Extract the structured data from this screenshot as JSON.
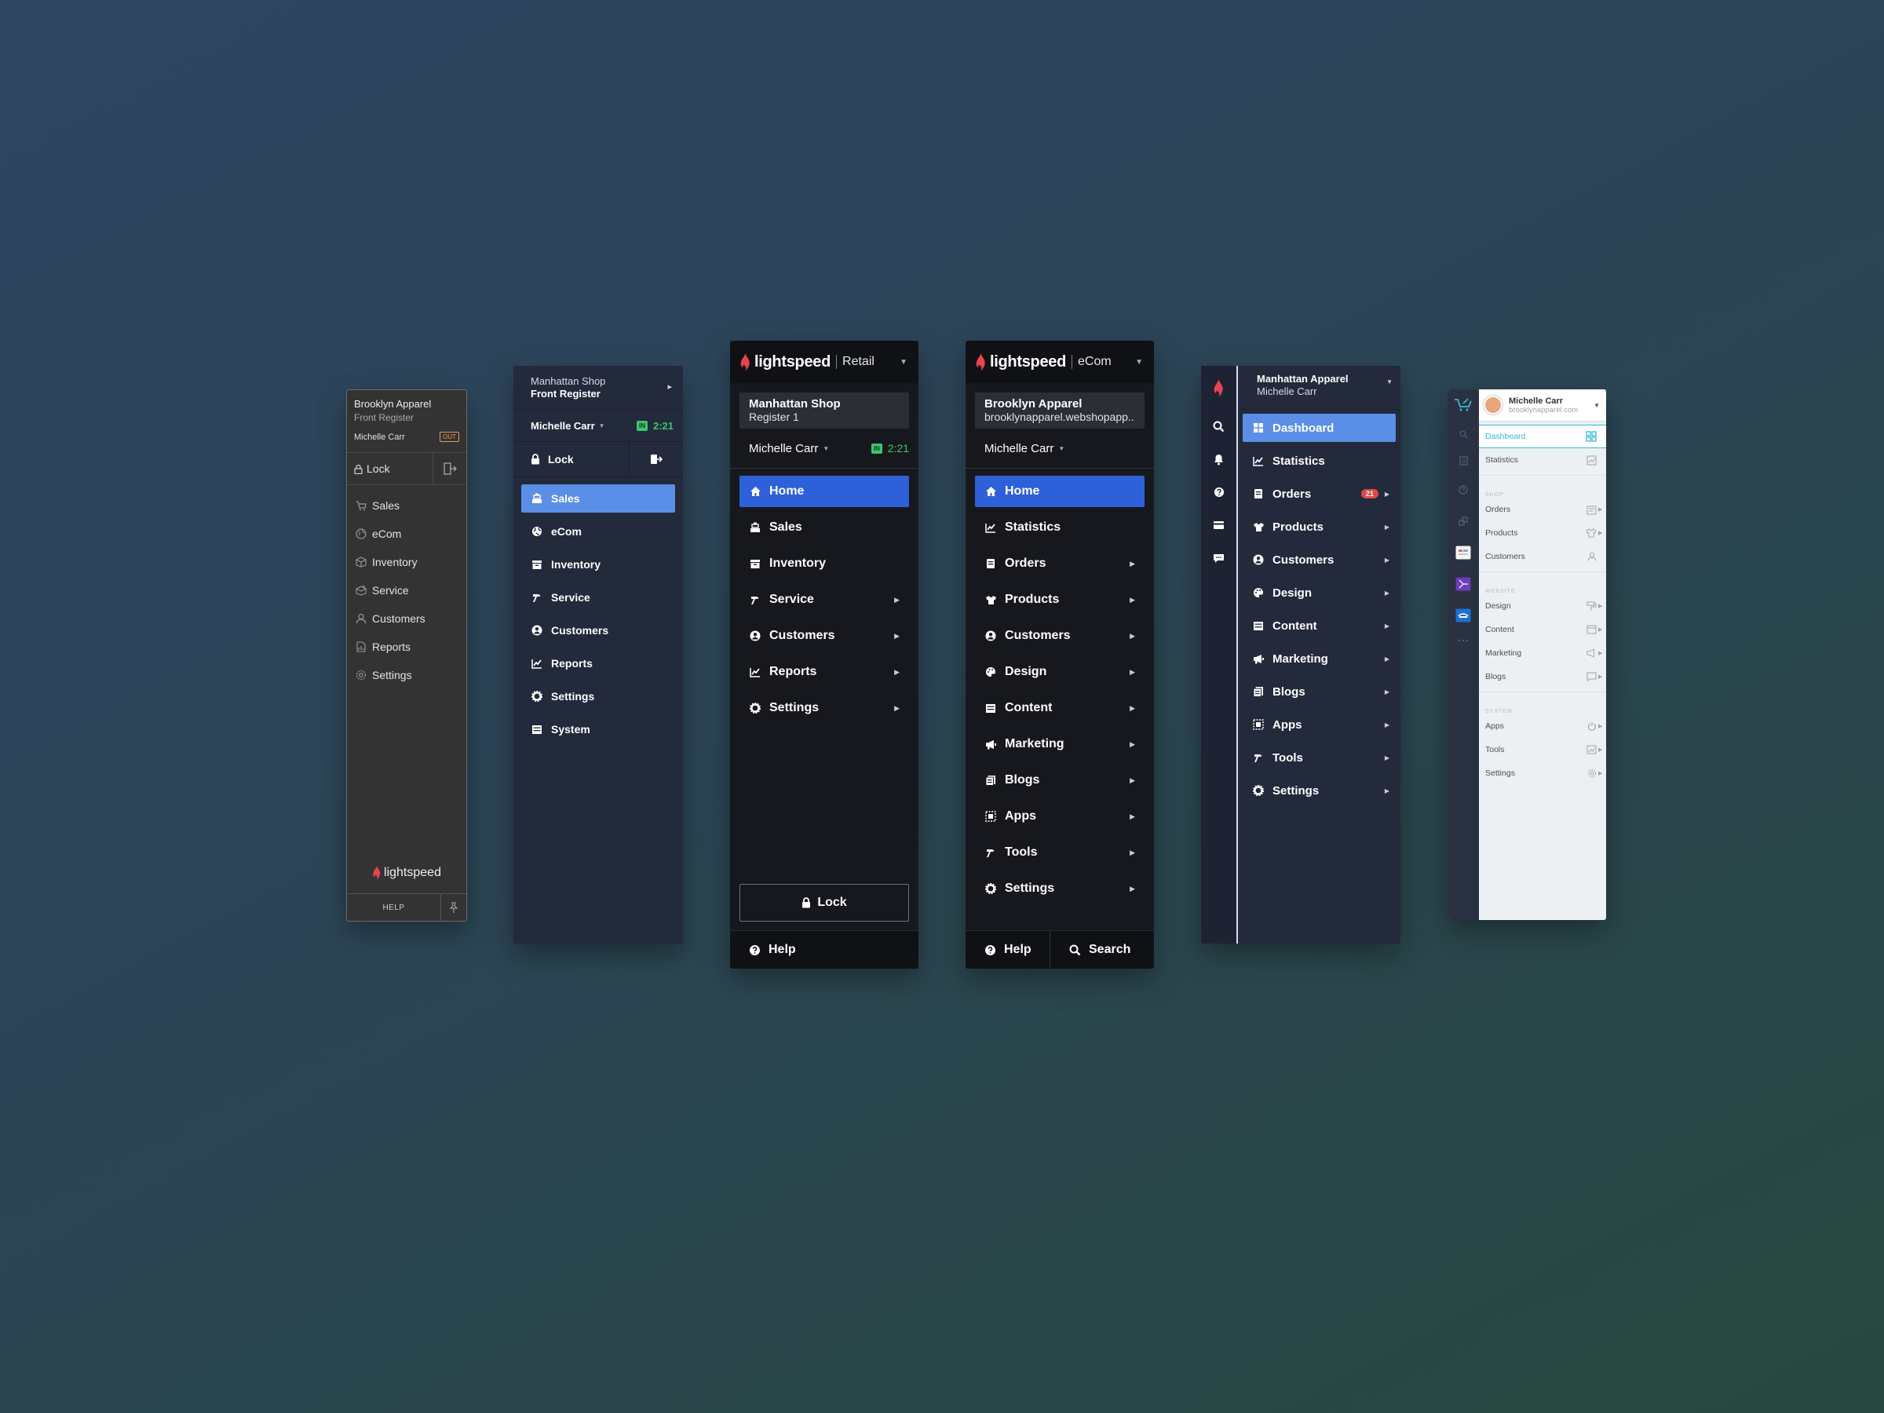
{
  "panel1": {
    "shop": "Brooklyn Apparel",
    "register": "Front Register",
    "user": "Michelle Carr",
    "status_badge": "OUT",
    "lock_label": "Lock",
    "nav": [
      {
        "label": "Sales",
        "icon": "cart-icon"
      },
      {
        "label": "eCom",
        "icon": "globe-icon"
      },
      {
        "label": "Inventory",
        "icon": "box-icon"
      },
      {
        "label": "Service",
        "icon": "wrench-box-icon"
      },
      {
        "label": "Customers",
        "icon": "person-icon"
      },
      {
        "label": "Reports",
        "icon": "report-icon"
      },
      {
        "label": "Settings",
        "icon": "gear-icon"
      }
    ],
    "brand": "lightspeed",
    "help_label": "HELP"
  },
  "panel2": {
    "shop": "Manhattan Shop",
    "register": "Front Register",
    "user": "Michelle Carr",
    "in_badge": "IN",
    "time": "2:21",
    "lock_label": "Lock",
    "nav": [
      {
        "label": "Sales",
        "icon": "register-icon",
        "active": true
      },
      {
        "label": "eCom",
        "icon": "globe-icon"
      },
      {
        "label": "Inventory",
        "icon": "inventory-icon"
      },
      {
        "label": "Service",
        "icon": "hammer-icon"
      },
      {
        "label": "Customers",
        "icon": "customer-icon"
      },
      {
        "label": "Reports",
        "icon": "chart-icon"
      },
      {
        "label": "Settings",
        "icon": "gear-icon"
      },
      {
        "label": "System",
        "icon": "system-icon"
      }
    ]
  },
  "panel3": {
    "brand": "lightspeed",
    "product": "Retail",
    "shop": "Manhattan Shop",
    "register": "Register 1",
    "user": "Michelle Carr",
    "in_badge": "IN",
    "time": "2:21",
    "nav": [
      {
        "label": "Home",
        "icon": "home-icon",
        "active": true
      },
      {
        "label": "Sales",
        "icon": "register-icon"
      },
      {
        "label": "Inventory",
        "icon": "inventory-icon"
      },
      {
        "label": "Service",
        "icon": "hammer-icon",
        "submenu": true
      },
      {
        "label": "Customers",
        "icon": "customer-icon",
        "submenu": true
      },
      {
        "label": "Reports",
        "icon": "chart-icon",
        "submenu": true
      },
      {
        "label": "Settings",
        "icon": "gear-icon",
        "submenu": true
      }
    ],
    "lock_label": "Lock",
    "help_label": "Help"
  },
  "panel4": {
    "brand": "lightspeed",
    "product": "eCom",
    "shop": "Brooklyn Apparel",
    "domain": "brooklynapparel.webshopapp...",
    "user": "Michelle Carr",
    "nav": [
      {
        "label": "Home",
        "icon": "home-icon",
        "active": true
      },
      {
        "label": "Statistics",
        "icon": "chart-icon"
      },
      {
        "label": "Orders",
        "icon": "orders-icon",
        "submenu": true
      },
      {
        "label": "Products",
        "icon": "shirt-icon",
        "submenu": true
      },
      {
        "label": "Customers",
        "icon": "customer-icon",
        "submenu": true
      },
      {
        "label": "Design",
        "icon": "palette-icon",
        "submenu": true
      },
      {
        "label": "Content",
        "icon": "content-icon",
        "submenu": true
      },
      {
        "label": "Marketing",
        "icon": "megaphone-icon",
        "submenu": true
      },
      {
        "label": "Blogs",
        "icon": "blogs-icon",
        "submenu": true
      },
      {
        "label": "Apps",
        "icon": "apps-icon",
        "submenu": true
      },
      {
        "label": "Tools",
        "icon": "hammer-icon",
        "submenu": true
      },
      {
        "label": "Settings",
        "icon": "gear-icon",
        "submenu": true
      }
    ],
    "help_label": "Help",
    "search_label": "Search"
  },
  "panel5": {
    "shop": "Manhattan Apparel",
    "user": "Michelle Carr",
    "rail": [
      "search-icon",
      "bell-icon",
      "help-icon",
      "card-icon",
      "chat-icon"
    ],
    "nav": [
      {
        "label": "Dashboard",
        "icon": "dashboard-icon",
        "active": true
      },
      {
        "label": "Statistics",
        "icon": "chart-icon"
      },
      {
        "label": "Orders",
        "icon": "orders-icon",
        "submenu": true,
        "count": "21"
      },
      {
        "label": "Products",
        "icon": "shirt-icon",
        "submenu": true
      },
      {
        "label": "Customers",
        "icon": "customer-icon",
        "submenu": true
      },
      {
        "label": "Design",
        "icon": "palette-icon",
        "submenu": true
      },
      {
        "label": "Content",
        "icon": "content-icon",
        "submenu": true
      },
      {
        "label": "Marketing",
        "icon": "megaphone-icon",
        "submenu": true
      },
      {
        "label": "Blogs",
        "icon": "blogs-icon",
        "submenu": true
      },
      {
        "label": "Apps",
        "icon": "apps-icon",
        "submenu": true
      },
      {
        "label": "Tools",
        "icon": "hammer-icon",
        "submenu": true
      },
      {
        "label": "Settings",
        "icon": "gear-icon",
        "submenu": true
      }
    ]
  },
  "panel6": {
    "user": "Michelle Carr",
    "domain": "brooklynapparel.com",
    "top_items": [
      {
        "label": "Dashboard",
        "icon": "dashboard-icon",
        "active": true
      },
      {
        "label": "Statistics",
        "icon": "chart-icon"
      }
    ],
    "sections": [
      {
        "title": "SHOP",
        "items": [
          {
            "label": "Orders",
            "icon": "orders-icon"
          },
          {
            "label": "Products",
            "icon": "shirt-icon"
          },
          {
            "label": "Customers",
            "icon": "person-icon"
          }
        ]
      },
      {
        "title": "WEBSITE",
        "items": [
          {
            "label": "Design",
            "icon": "paint-roller-icon"
          },
          {
            "label": "Content",
            "icon": "content-icon"
          },
          {
            "label": "Marketing",
            "icon": "megaphone-icon"
          },
          {
            "label": "Blogs",
            "icon": "comment-icon"
          }
        ]
      },
      {
        "title": "SYSTEM",
        "items": [
          {
            "label": "Apps",
            "icon": "power-icon"
          },
          {
            "label": "Tools",
            "icon": "tools-icon"
          },
          {
            "label": "Settings",
            "icon": "gear-icon"
          }
        ]
      }
    ]
  },
  "colors": {
    "lightspeed_red": "#e8434f",
    "active_blue": "#2e60d9",
    "active_light_blue": "#5b8ee6",
    "status_green": "#3ec46d",
    "teal_accent": "#33b9d6",
    "alert_red": "#e04848"
  }
}
